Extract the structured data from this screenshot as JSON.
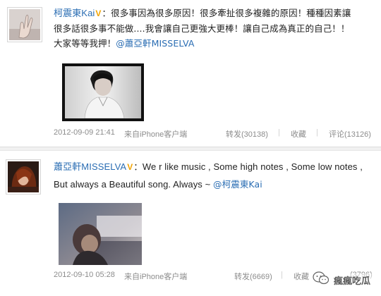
{
  "post1": {
    "author": "柯震東Kai",
    "verified_badge": "V",
    "colon": "：",
    "text_line1": "很多事因為很多原因！很多牽扯很多複雜的原因！種種因素讓",
    "text_line2": "很多話很多事不能做....我會讓自己更強大更棒！讓自己成為真正的自己！！",
    "text_line3_prefix": "大家等等我押！",
    "mention": "@蕭亞軒MISSELVA",
    "timestamp": "2012-09-09 21:41",
    "source": "来自iPhone客户端",
    "repost_label": "转发(30138)",
    "favorite_label": "收藏",
    "comment_label": "评论(13126)"
  },
  "post2": {
    "author": "蕭亞軒MISSELVA",
    "verified_badge": "V",
    "colon": "：",
    "text_line1": "We r like music , Some high notes , Some low notes ,",
    "text_line2_prefix": "But always a Beautiful song. Always ~ ",
    "mention": "@柯震東Kai",
    "timestamp": "2012-09-10 05:28",
    "source": "来自iPhone客户端",
    "repost_label": "转发(6669)",
    "favorite_label": "收藏",
    "comment_label": "(3796)"
  },
  "watermark": {
    "text": "瘋瘋吃瓜"
  },
  "colors": {
    "link": "#2a6db3",
    "badge": "#f2a400",
    "meta": "#8c8c8c"
  }
}
